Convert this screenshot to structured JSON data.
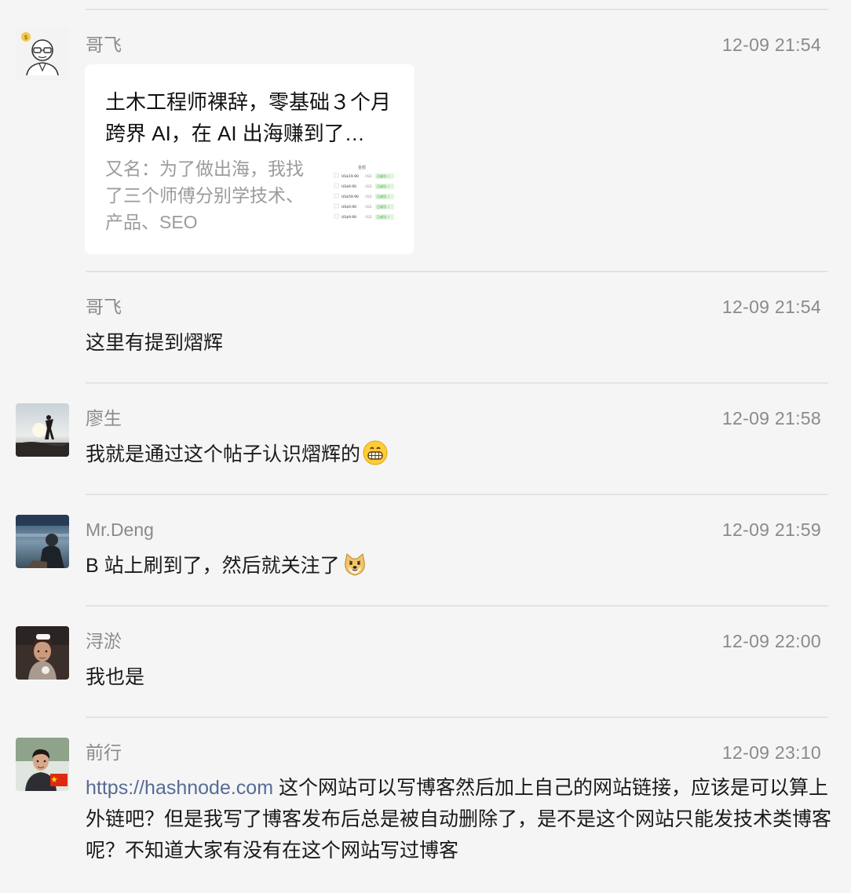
{
  "messages": [
    {
      "name": "哥飞",
      "time": "12-09 21:54",
      "card": {
        "title": "土木工程师裸辞，零基础３个月跨界 AI，在 AI 出海赚到了…",
        "desc": "又名：为了做出海，我找了三个师傅分别学技术、产品、SEO",
        "thumb_header": "金额",
        "thumb_rows": [
          {
            "amount": "US$19.90",
            "currency": "USD",
            "status": "已成功 ✓"
          },
          {
            "amount": "US$9.90",
            "currency": "USD",
            "status": "已成功 ✓"
          },
          {
            "amount": "US$59.90",
            "currency": "USD",
            "status": "已成功 ✓"
          },
          {
            "amount": "US$9.90",
            "currency": "USD",
            "status": "已成功 ✓"
          },
          {
            "amount": "US$9.90",
            "currency": "USD",
            "status": "已成功 ✓"
          }
        ]
      }
    },
    {
      "name": "哥飞",
      "time": "12-09 21:54",
      "text": "这里有提到熠辉"
    },
    {
      "name": "廖生",
      "time": "12-09 21:58",
      "text": "我就是通过这个帖子认识熠辉的",
      "emoji": "grin-emoji"
    },
    {
      "name": "Mr.Deng",
      "time": "12-09 21:59",
      "text": "B 站上刷到了，然后就关注了",
      "emoji": "doge-emoji"
    },
    {
      "name": "浔淤",
      "time": "12-09 22:00",
      "text": "我也是"
    },
    {
      "name": "前行",
      "time": "12-09 23:10",
      "link": "https://hashnode.com",
      "text": " 这个网站可以写博客然后加上自己的网站链接，应该是可以算上外链吧？但是我写了博客发布后总是被自动删除了，是不是这个网站只能发技术类博客呢？不知道大家有没有在这个网站写过博客"
    }
  ]
}
